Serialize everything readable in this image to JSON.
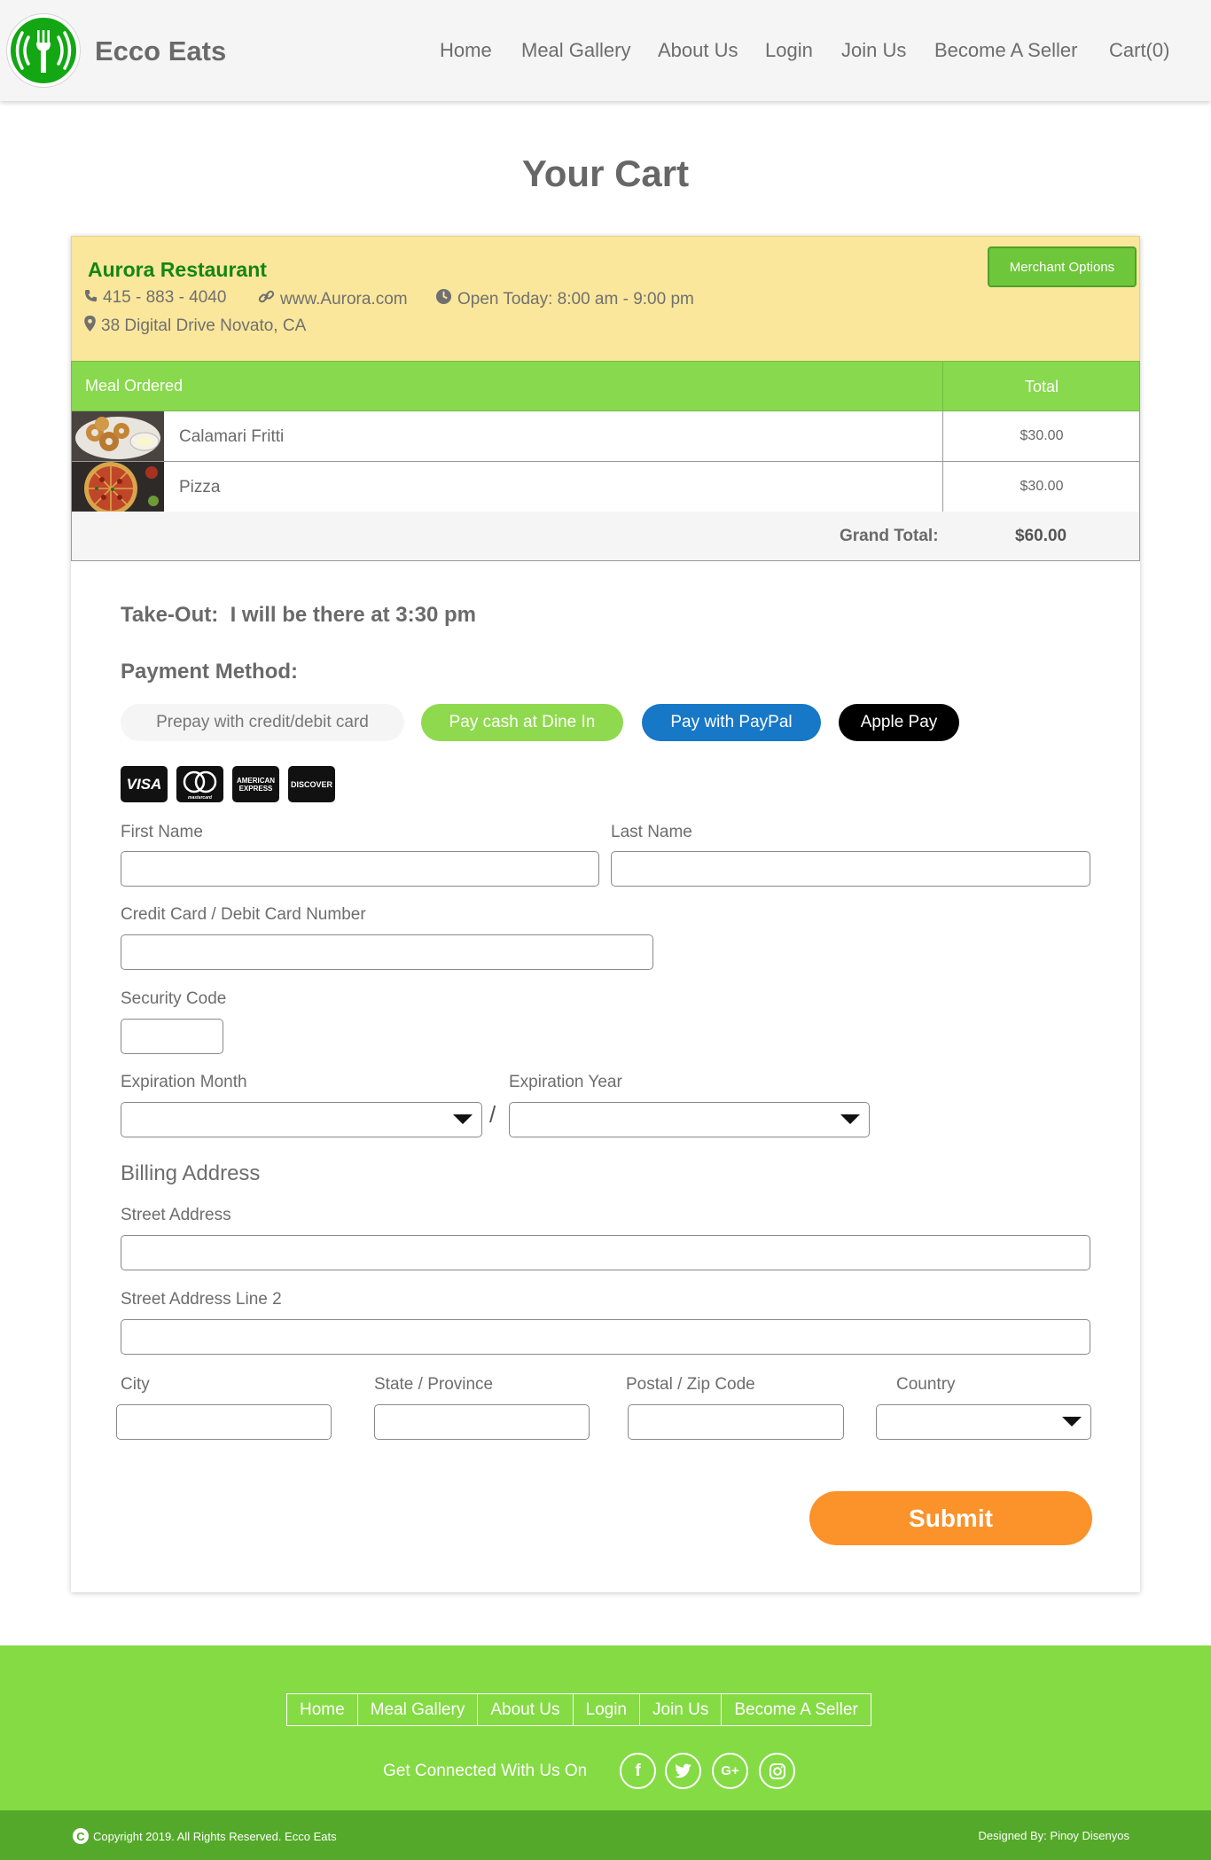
{
  "header": {
    "brand": "Ecco Eats",
    "nav": [
      "Home",
      "Meal Gallery",
      "About Us",
      "Login",
      "Join Us",
      "Become A Seller",
      "Cart(0)"
    ]
  },
  "page_title": "Your Cart",
  "restaurant": {
    "name": "Aurora Restaurant",
    "phone": "415 - 883 - 4040",
    "website": "www.Aurora.com",
    "hours": "Open Today: 8:00 am - 9:00 pm",
    "address": "38 Digital Drive Novato, CA",
    "merchant_button": "Merchant Options"
  },
  "order_table": {
    "col_meal": "Meal Ordered",
    "col_total": "Total",
    "items": [
      {
        "name": "Calamari Fritti",
        "price": "$30.00"
      },
      {
        "name": "Pizza",
        "price": "$30.00"
      }
    ],
    "grand_total_label": "Grand Total:",
    "grand_total_value": "$60.00"
  },
  "takeout": "Take-Out:  I will be there at 3:30 pm",
  "payment": {
    "title": "Payment Method:",
    "options": [
      "Prepay with credit/debit card",
      "Pay cash at Dine In",
      "Pay with PayPal",
      "Apple Pay"
    ],
    "cards": [
      "VISA",
      "mastercard",
      "AMERICAN EXPRESS",
      "DISCOVER"
    ]
  },
  "form": {
    "first_name": "First Name",
    "last_name": "Last Name",
    "card_number": "Credit Card / Debit Card Number",
    "security_code": "Security Code",
    "exp_month": "Expiration Month",
    "exp_year": "Expiration Year",
    "slash": "/",
    "billing_title": "Billing Address",
    "street": "Street Address",
    "street2": "Street Address Line 2",
    "city": "City",
    "state": "State / Province",
    "zip": "Postal / Zip Code",
    "country": "Country",
    "submit": "Submit"
  },
  "footer": {
    "nav": [
      "Home",
      "Meal Gallery",
      "About Us",
      "Login",
      "Join Us",
      "Become A Seller"
    ],
    "connect": "Get Connected With Us On",
    "social": [
      "facebook-icon",
      "twitter-icon",
      "google-plus-icon",
      "instagram-icon"
    ],
    "copyright": "Copyright 2019. All Rights Reserved. Ecco Eats",
    "designed_by": "Designed By: Pinoy Disenyos"
  },
  "colors": {
    "brand_green": "#14a714",
    "accent_green": "#84db44",
    "paypal_blue": "#1778c7",
    "submit_orange": "#fb922a",
    "restaurant_bg": "#fae79b"
  }
}
